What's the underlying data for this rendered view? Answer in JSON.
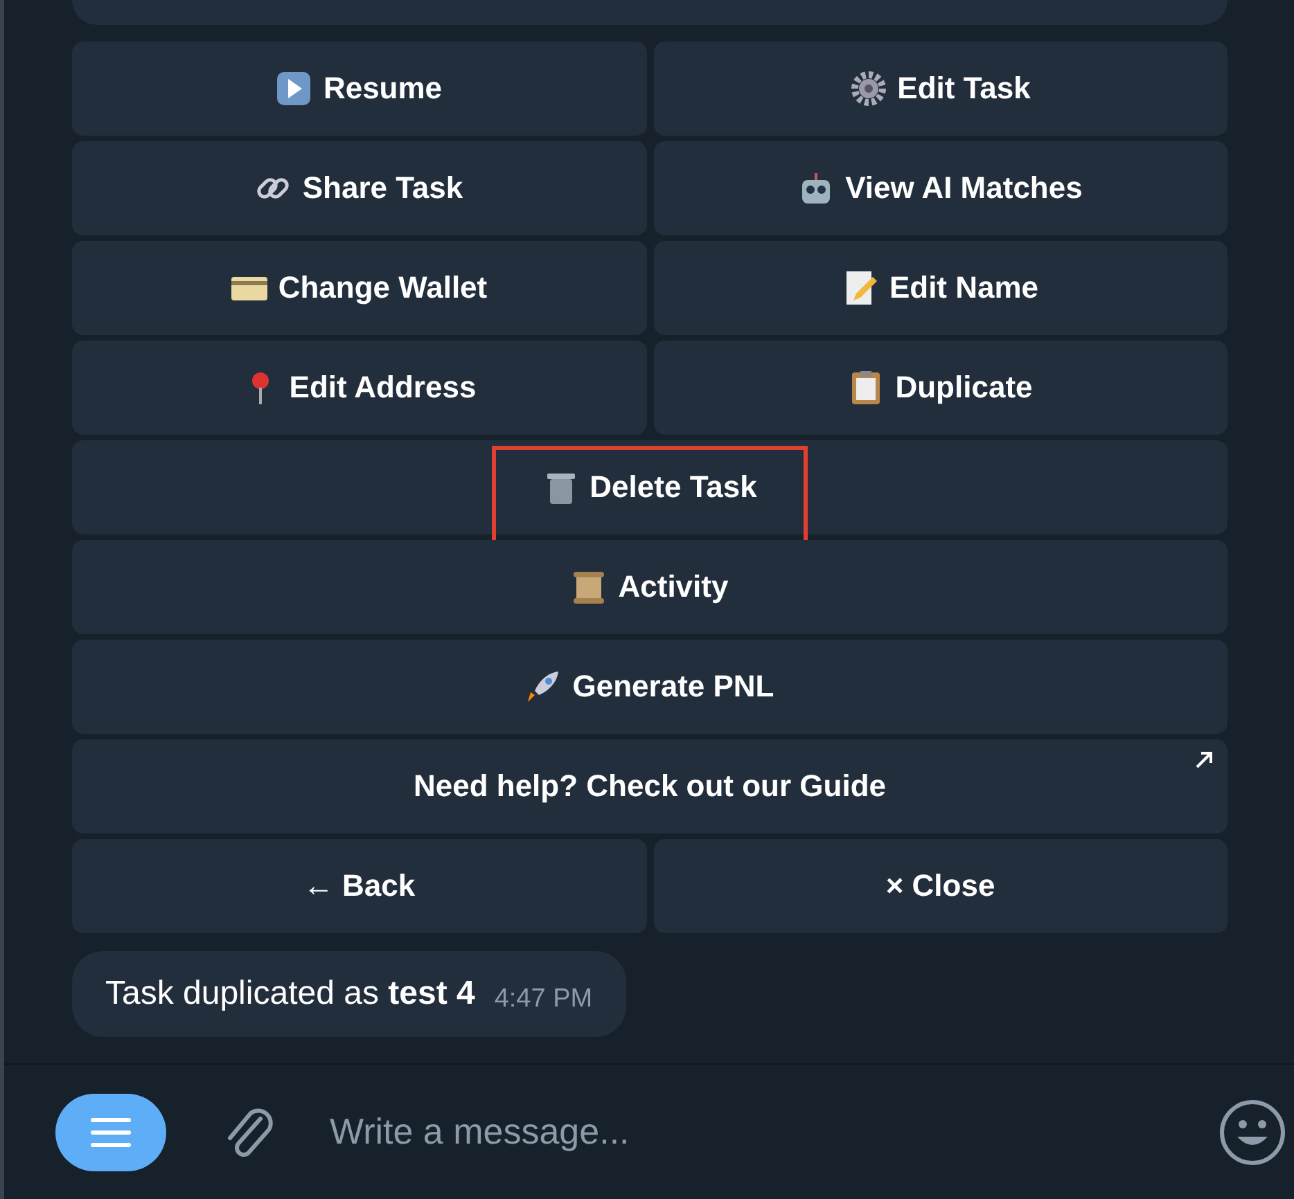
{
  "keyboard": {
    "rows": [
      [
        {
          "label": "Resume",
          "highlighted": false
        },
        {
          "label": "Edit Task",
          "highlighted": false
        }
      ],
      [
        {
          "label": "Share Task",
          "highlighted": false
        },
        {
          "label": "View AI Matches",
          "highlighted": false
        }
      ],
      [
        {
          "label": "Change Wallet",
          "highlighted": false
        },
        {
          "label": "Edit Name",
          "highlighted": false
        }
      ],
      [
        {
          "label": "Edit Address",
          "highlighted": false
        },
        {
          "label": "Duplicate",
          "highlighted": false
        }
      ],
      [
        {
          "label": "Delete Task",
          "highlighted": true
        }
      ],
      [
        {
          "label": "Activity",
          "highlighted": false
        }
      ],
      [
        {
          "label": "Generate PNL",
          "highlighted": false
        }
      ],
      [
        {
          "label": "Need help? Check out our Guide",
          "highlighted": false,
          "external": true
        }
      ],
      [
        {
          "label": "← Back",
          "highlighted": false
        },
        {
          "label": "× Close",
          "highlighted": false
        }
      ]
    ]
  },
  "message": {
    "text": "Task duplicated as **test 4**",
    "time": "4:47 PM"
  },
  "composer": {
    "placeholder": "Write a message..."
  }
}
